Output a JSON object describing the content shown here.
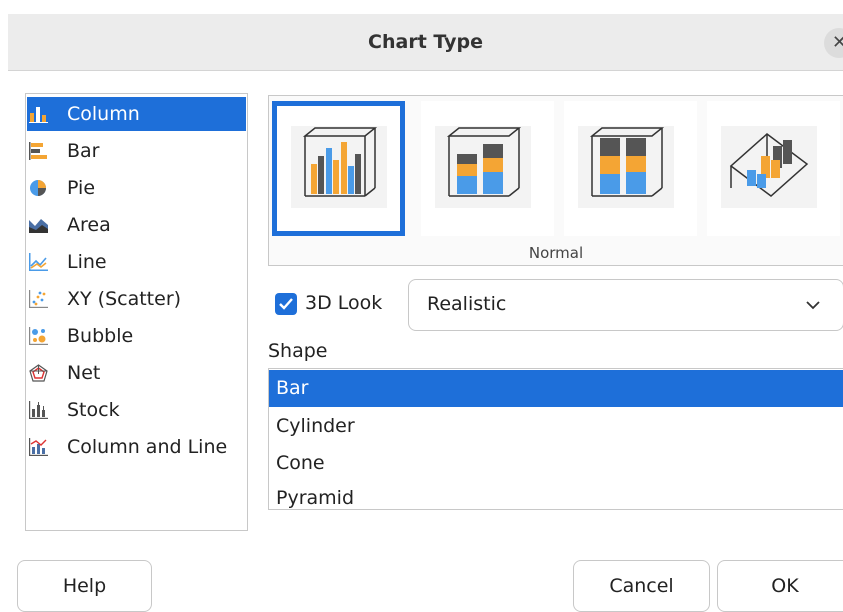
{
  "dialog": {
    "title": "Chart Type"
  },
  "chart_types": [
    {
      "label": "Column",
      "icon": "column-chart-icon",
      "selected": true
    },
    {
      "label": "Bar",
      "icon": "bar-chart-icon"
    },
    {
      "label": "Pie",
      "icon": "pie-chart-icon"
    },
    {
      "label": "Area",
      "icon": "area-chart-icon"
    },
    {
      "label": "Line",
      "icon": "line-chart-icon"
    },
    {
      "label": "XY (Scatter)",
      "icon": "scatter-chart-icon"
    },
    {
      "label": "Bubble",
      "icon": "bubble-chart-icon"
    },
    {
      "label": "Net",
      "icon": "net-chart-icon"
    },
    {
      "label": "Stock",
      "icon": "stock-chart-icon"
    },
    {
      "label": "Column and Line",
      "icon": "column-line-chart-icon"
    }
  ],
  "subtypes": {
    "caption": "Normal",
    "selected_index": 0
  },
  "look": {
    "checkbox_label": "3D Look",
    "checked": true,
    "scheme_value": "Realistic"
  },
  "shape": {
    "label": "Shape",
    "items": [
      "Bar",
      "Cylinder",
      "Cone",
      "Pyramid"
    ],
    "selected_index": 0
  },
  "buttons": {
    "help": "Help",
    "cancel": "Cancel",
    "ok": "OK"
  },
  "colors": {
    "accent": "#1e6fd9",
    "bar_orange": "#f4a534",
    "bar_blue": "#4a9be8",
    "bar_dark": "#555555"
  }
}
